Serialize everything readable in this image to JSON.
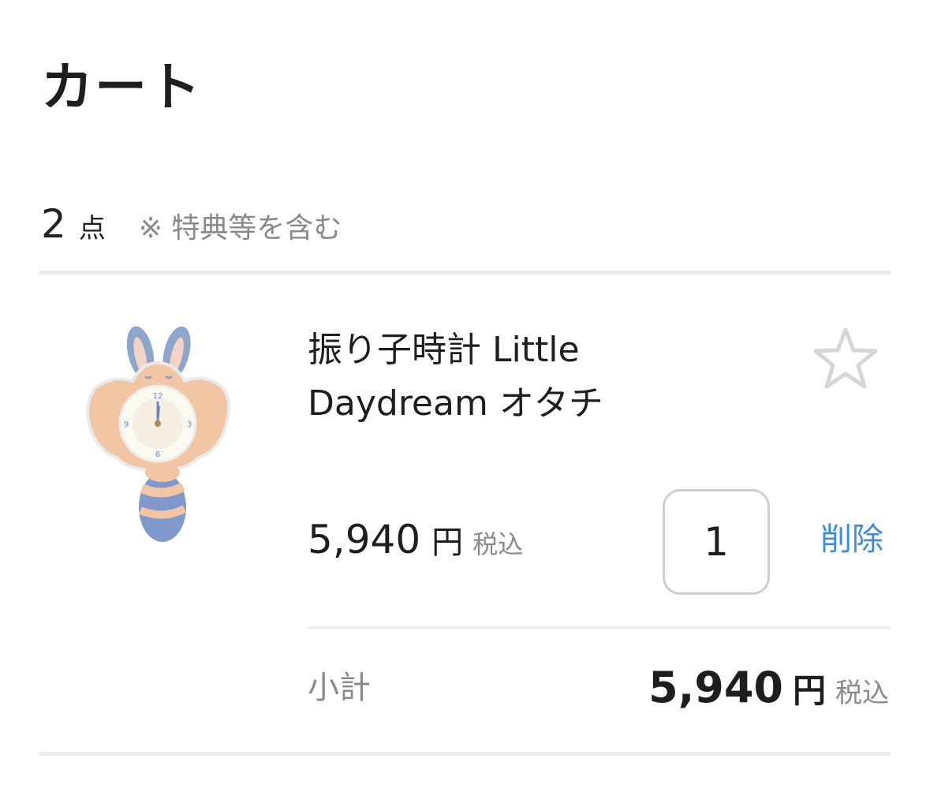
{
  "header": {
    "title": "カート"
  },
  "summary": {
    "count": "2",
    "count_unit": "点",
    "note": "※ 特典等を含む"
  },
  "cart_items": [
    {
      "name": "振り子時計 Little Daydream オタチ",
      "image_icon": "pendulum-clock-product-image",
      "price": "5,940",
      "currency": "円",
      "tax_label": "税込",
      "quantity": "1",
      "delete_label": "削除",
      "favorite_icon": "star-outline-icon"
    }
  ],
  "subtotal": {
    "label": "小計",
    "value": "5,940",
    "currency": "円",
    "tax_label": "税込"
  },
  "colors": {
    "accent_link": "#3f8be0",
    "text_primary": "#1e1e1e",
    "text_muted": "#8a8a8a",
    "divider": "#ececec",
    "border": "#cfcfcf"
  }
}
